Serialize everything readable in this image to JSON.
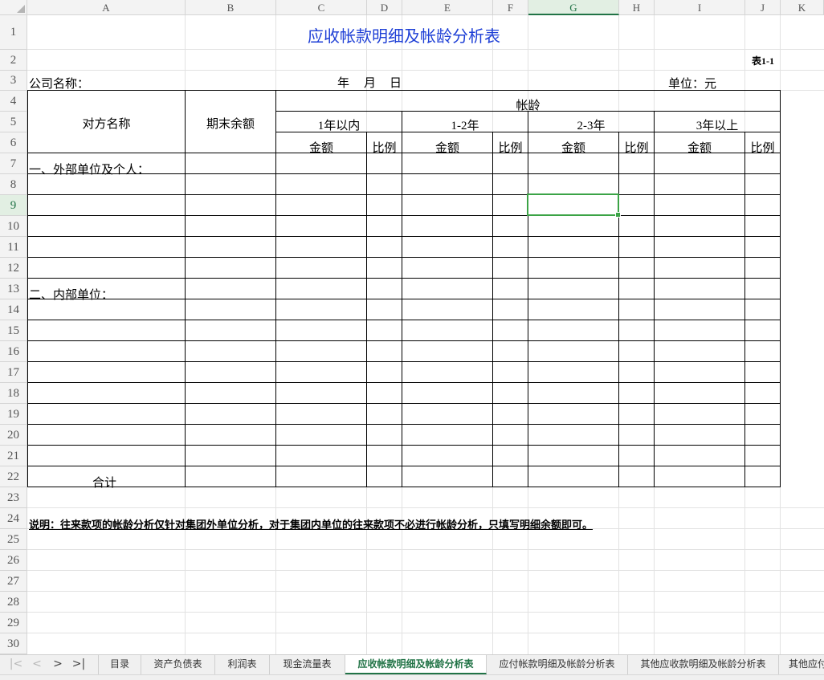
{
  "columns": [
    "A",
    "B",
    "C",
    "D",
    "E",
    "F",
    "G",
    "H",
    "I",
    "J",
    "K"
  ],
  "rows": [
    "1",
    "2",
    "3",
    "4",
    "5",
    "6",
    "7",
    "8",
    "9",
    "10",
    "11",
    "12",
    "13",
    "14",
    "15",
    "16",
    "17",
    "18",
    "19",
    "20",
    "21",
    "22",
    "23",
    "24",
    "25",
    "26",
    "27",
    "28",
    "29",
    "30"
  ],
  "selected_cell": "G9",
  "form": {
    "title": "应收帐款明细及帐龄分析表",
    "table_no": "表1-1",
    "company_label": "公司名称：",
    "date_year": "年",
    "date_month": "月",
    "date_day": "日",
    "unit_label": "单位：元",
    "header_party": "对方名称",
    "header_balance": "期末余额",
    "header_aging": "帐龄",
    "aging_ranges": [
      "1年以内",
      "1-2年",
      "2-3年",
      "3年以上"
    ],
    "amount_label": "金额",
    "ratio_label": "比例",
    "section_external": "一、外部单位及个人：",
    "section_internal": "二、内部单位：",
    "total_label": "合计",
    "note": "说明：往来款项的帐龄分析仅针对集团外单位分析，对于集团内单位的往来款项不必进行帐龄分析，只填写明细余额即可。"
  },
  "sheet_tabs": [
    "目录",
    "资产负债表",
    "利润表",
    "现金流量表",
    "应收帐款明细及帐龄分析表",
    "应付帐款明细及帐龄分析表",
    "其他应收款明细及帐龄分析表",
    "其他应付"
  ],
  "active_tab": "应收帐款明细及帐龄分析表",
  "colors": {
    "accent": "#217346",
    "title": "#1e3fd6",
    "selection": "#3ba346"
  }
}
